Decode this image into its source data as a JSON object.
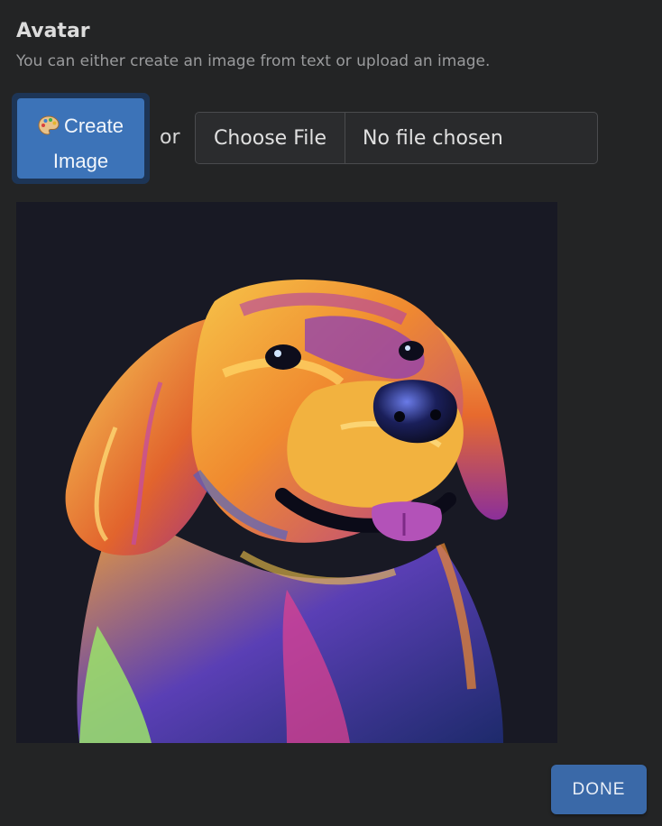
{
  "section": {
    "title": "Avatar",
    "subtitle": "You can either create an image from text or upload an image."
  },
  "actions": {
    "create_label_line1": "Create",
    "create_label_line2": "Image",
    "create_icon": "palette-icon",
    "or_text": "or"
  },
  "file_input": {
    "button_label": "Choose File",
    "status": "No file chosen"
  },
  "avatar": {
    "image": "colorful-dog-portrait"
  },
  "footer": {
    "done_label": "DONE"
  },
  "colors": {
    "primary": "#3c73b8",
    "done": "#3a69a8",
    "background": "#232425",
    "image_background": "#181924"
  }
}
